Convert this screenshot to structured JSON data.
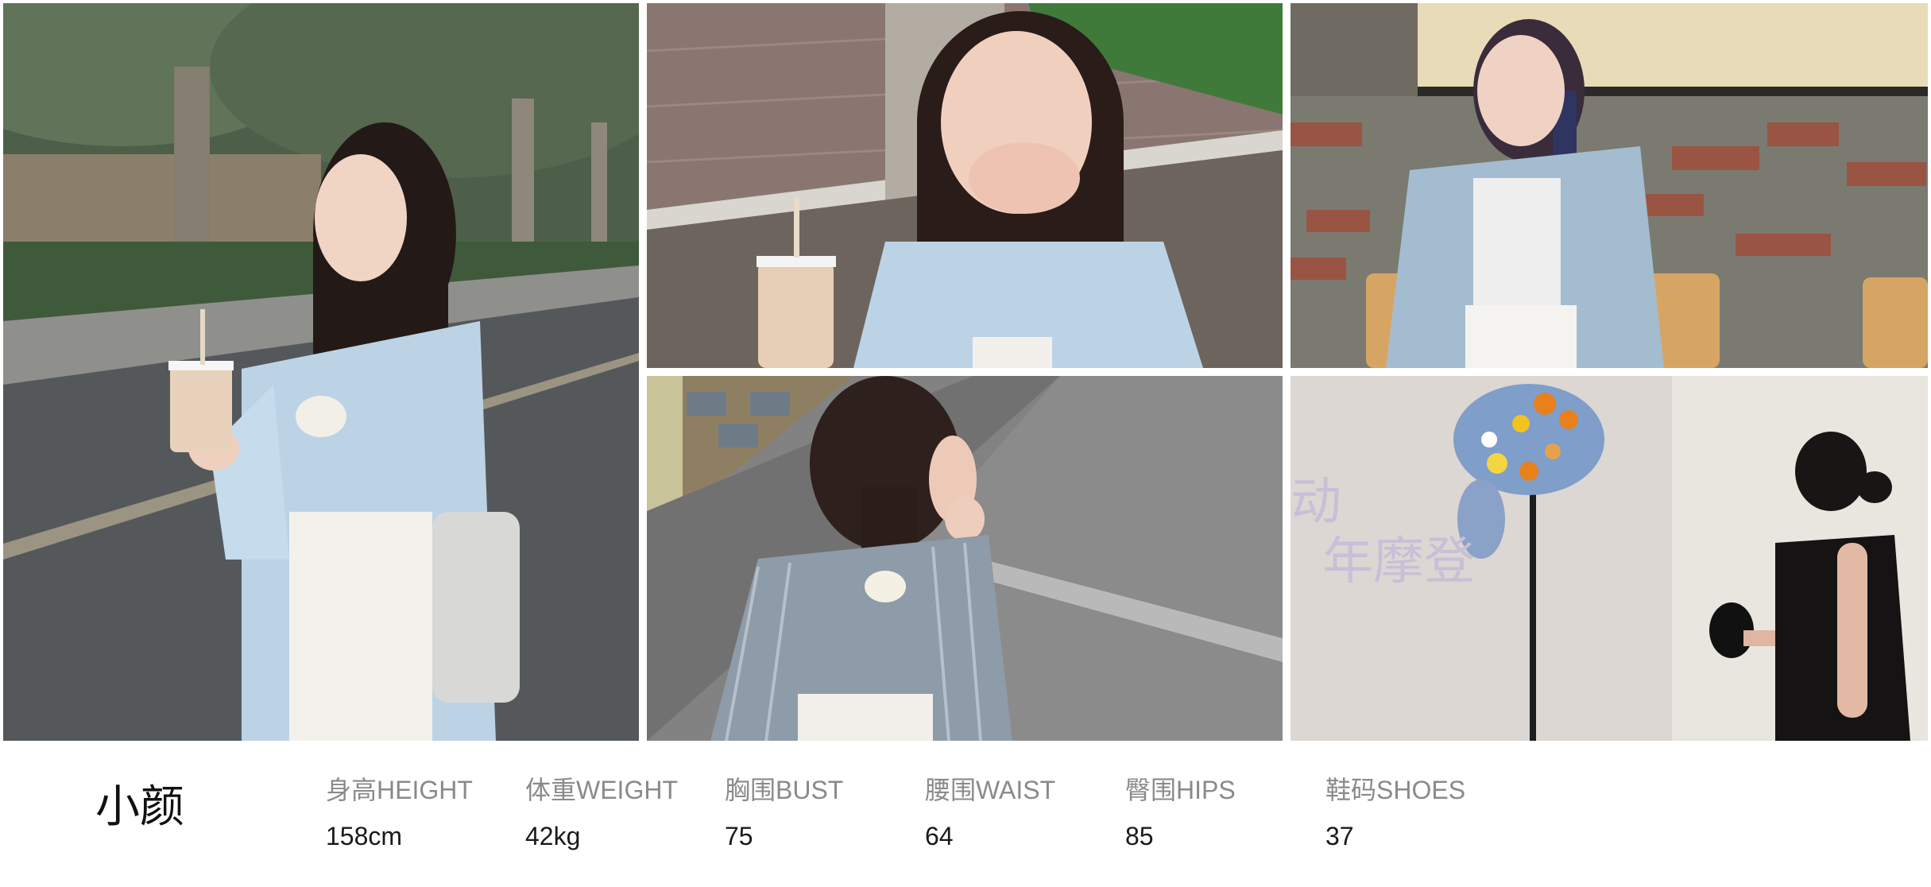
{
  "model": {
    "name": "小颜"
  },
  "stats": [
    {
      "label": "身高HEIGHT",
      "value": "158cm"
    },
    {
      "label": "体重WEIGHT",
      "value": "42kg"
    },
    {
      "label": "胸围BUST",
      "value": "75"
    },
    {
      "label": "腰围WAIST",
      "value": "64"
    },
    {
      "label": "臀围HIPS",
      "value": "85"
    },
    {
      "label": "鞋码SHOES",
      "value": "37"
    }
  ],
  "photos": {
    "wall_sign_text": "年摩登",
    "wall_sign_char": "动"
  },
  "colors": {
    "shirt_blue": "#bcd3e6",
    "road_gray": "#55585b",
    "foliage_green": "#3f5a3a",
    "brick_red": "#9a5443",
    "label_gray": "#8a8a8a",
    "value_black": "#1a1a1a"
  }
}
